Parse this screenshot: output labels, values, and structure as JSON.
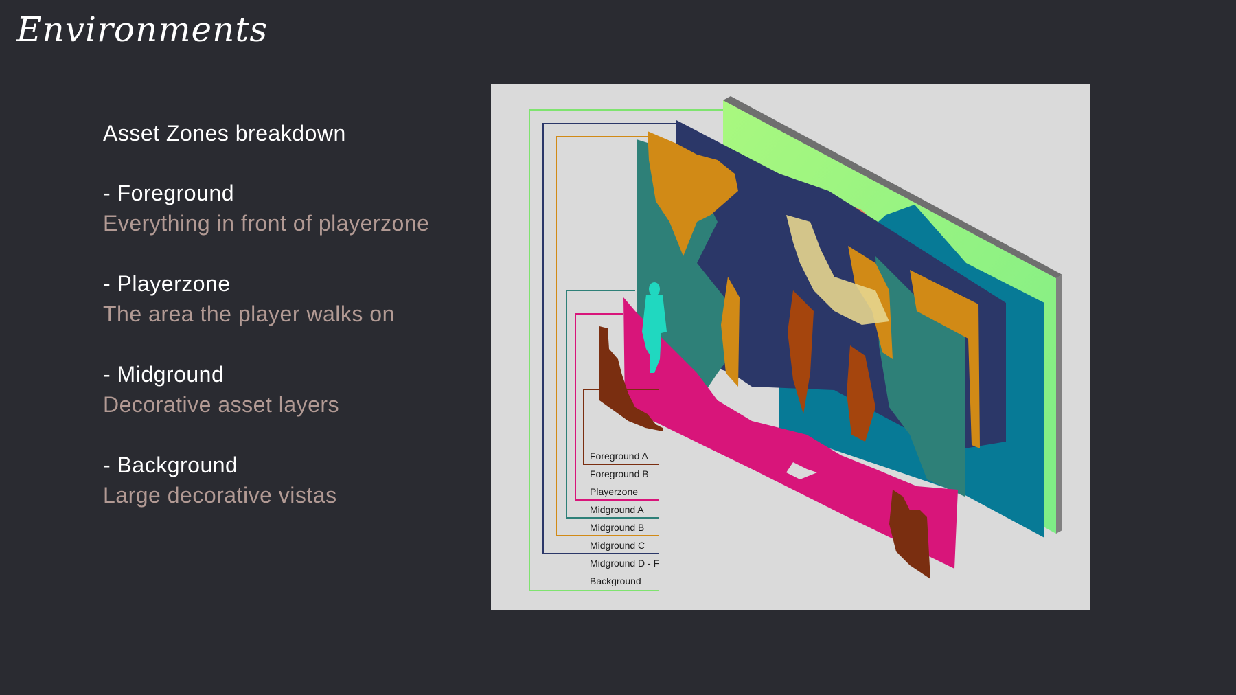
{
  "page": {
    "title": "Environments"
  },
  "panel": {
    "subtitle": "Asset Zones breakdown",
    "zones": [
      {
        "name": "- Foreground",
        "description": "Everything in front of playerzone"
      },
      {
        "name": "- Playerzone",
        "description": "The area the player walks on"
      },
      {
        "name": "- Midground",
        "description": "Decorative asset layers"
      },
      {
        "name": "- Background",
        "description": "Large decorative vistas"
      }
    ]
  },
  "diagram": {
    "layers": [
      {
        "label": "Foreground A",
        "color": "#7a2e10"
      },
      {
        "label": "Foreground B",
        "color": "#7a2e10"
      },
      {
        "label": "Playerzone",
        "color": "#d8157a"
      },
      {
        "label": "Midground A",
        "color": "#2e8078"
      },
      {
        "label": "Midground B",
        "color": "#d18a16"
      },
      {
        "label": "Midground C",
        "color": "#2b3768"
      },
      {
        "label": "Midground D - F",
        "color": "#077a96"
      },
      {
        "label": "Background",
        "color": "#7fe36f"
      }
    ]
  }
}
